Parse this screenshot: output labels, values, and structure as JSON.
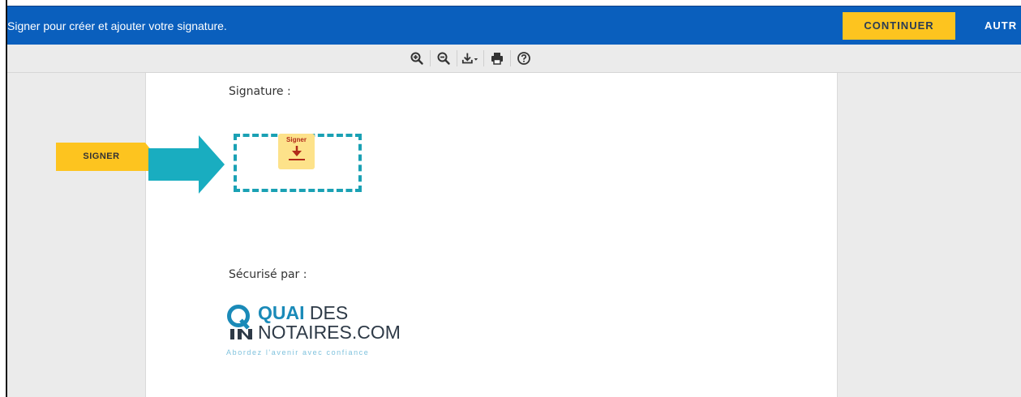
{
  "topbar": {
    "message": "Signer pour créer et ajouter votre signature.",
    "continue_label": "CONTINUER",
    "other_label": "AUTR",
    "bg_color": "#0a5fbd",
    "button_color": "#fdc41f"
  },
  "toolbar": {
    "tools": [
      "zoom-in-icon",
      "zoom-out-icon",
      "download-icon",
      "print-icon",
      "help-icon"
    ]
  },
  "document": {
    "signature_label": "Signature :",
    "sign_field_label": "Signer",
    "secured_label": "Sécurisé par :",
    "logo": {
      "line1_bold": "QUAI",
      "line1_rest": " DES",
      "line2": "NOTAIRES.COM",
      "tagline": "Abordez l'avenir avec confiance"
    }
  },
  "annotation": {
    "signer_tab_label": "SIGNER",
    "arrow_color": "#19adc0",
    "tab_color": "#fdc41f"
  }
}
